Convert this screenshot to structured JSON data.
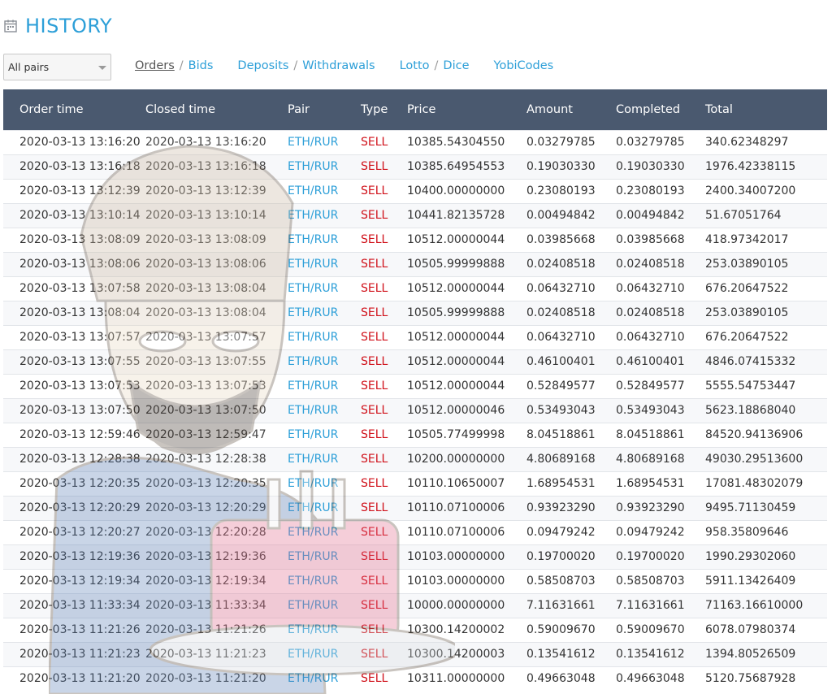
{
  "header": {
    "title": "HISTORY",
    "icon": "calendar-icon"
  },
  "filter": {
    "selected": "All pairs"
  },
  "nav": [
    {
      "label": "Orders",
      "active": true
    },
    {
      "label": "Bids",
      "active": false
    },
    {
      "label": "Deposits",
      "active": false
    },
    {
      "label": "Withdrawals",
      "active": false
    },
    {
      "label": "Lotto",
      "active": false
    },
    {
      "label": "Dice",
      "active": false
    },
    {
      "label": "YobiCodes",
      "active": false
    }
  ],
  "table": {
    "headers": [
      "Order time",
      "Closed time",
      "Pair",
      "Type",
      "Price",
      "Amount",
      "Completed",
      "Total"
    ],
    "rows": [
      [
        "2020-03-13 13:16:20",
        "2020-03-13 13:16:20",
        "ETH/RUR",
        "SELL",
        "10385.54304550",
        "0.03279785",
        "0.03279785",
        "340.62348297"
      ],
      [
        "2020-03-13 13:16:18",
        "2020-03-13 13:16:18",
        "ETH/RUR",
        "SELL",
        "10385.64954553",
        "0.19030330",
        "0.19030330",
        "1976.42338115"
      ],
      [
        "2020-03-13 13:12:39",
        "2020-03-13 13:12:39",
        "ETH/RUR",
        "SELL",
        "10400.00000000",
        "0.23080193",
        "0.23080193",
        "2400.34007200"
      ],
      [
        "2020-03-13 13:10:14",
        "2020-03-13 13:10:14",
        "ETH/RUR",
        "SELL",
        "10441.82135728",
        "0.00494842",
        "0.00494842",
        "51.67051764"
      ],
      [
        "2020-03-13 13:08:09",
        "2020-03-13 13:08:09",
        "ETH/RUR",
        "SELL",
        "10512.00000044",
        "0.03985668",
        "0.03985668",
        "418.97342017"
      ],
      [
        "2020-03-13 13:08:06",
        "2020-03-13 13:08:06",
        "ETH/RUR",
        "SELL",
        "10505.99999888",
        "0.02408518",
        "0.02408518",
        "253.03890105"
      ],
      [
        "2020-03-13 13:07:58",
        "2020-03-13 13:08:04",
        "ETH/RUR",
        "SELL",
        "10512.00000044",
        "0.06432710",
        "0.06432710",
        "676.20647522"
      ],
      [
        "2020-03-13 13:08:04",
        "2020-03-13 13:08:04",
        "ETH/RUR",
        "SELL",
        "10505.99999888",
        "0.02408518",
        "0.02408518",
        "253.03890105"
      ],
      [
        "2020-03-13 13:07:57",
        "2020-03-13 13:07:57",
        "ETH/RUR",
        "SELL",
        "10512.00000044",
        "0.06432710",
        "0.06432710",
        "676.20647522"
      ],
      [
        "2020-03-13 13:07:55",
        "2020-03-13 13:07:55",
        "ETH/RUR",
        "SELL",
        "10512.00000044",
        "0.46100401",
        "0.46100401",
        "4846.07415332"
      ],
      [
        "2020-03-13 13:07:53",
        "2020-03-13 13:07:53",
        "ETH/RUR",
        "SELL",
        "10512.00000044",
        "0.52849577",
        "0.52849577",
        "5555.54753447"
      ],
      [
        "2020-03-13 13:07:50",
        "2020-03-13 13:07:50",
        "ETH/RUR",
        "SELL",
        "10512.00000046",
        "0.53493043",
        "0.53493043",
        "5623.18868040"
      ],
      [
        "2020-03-13 12:59:46",
        "2020-03-13 12:59:47",
        "ETH/RUR",
        "SELL",
        "10505.77499998",
        "8.04518861",
        "8.04518861",
        "84520.94136906"
      ],
      [
        "2020-03-13 12:28:38",
        "2020-03-13 12:28:38",
        "ETH/RUR",
        "SELL",
        "10200.00000000",
        "4.80689168",
        "4.80689168",
        "49030.29513600"
      ],
      [
        "2020-03-13 12:20:35",
        "2020-03-13 12:20:35",
        "ETH/RUR",
        "SELL",
        "10110.10650007",
        "1.68954531",
        "1.68954531",
        "17081.48302079"
      ],
      [
        "2020-03-13 12:20:29",
        "2020-03-13 12:20:29",
        "ETH/RUR",
        "SELL",
        "10110.07100006",
        "0.93923290",
        "0.93923290",
        "9495.71130459"
      ],
      [
        "2020-03-13 12:20:27",
        "2020-03-13 12:20:28",
        "ETH/RUR",
        "SELL",
        "10110.07100006",
        "0.09479242",
        "0.09479242",
        "958.35809646"
      ],
      [
        "2020-03-13 12:19:36",
        "2020-03-13 12:19:36",
        "ETH/RUR",
        "SELL",
        "10103.00000000",
        "0.19700020",
        "0.19700020",
        "1990.29302060"
      ],
      [
        "2020-03-13 12:19:34",
        "2020-03-13 12:19:34",
        "ETH/RUR",
        "SELL",
        "10103.00000000",
        "0.58508703",
        "0.58508703",
        "5911.13426409"
      ],
      [
        "2020-03-13 11:33:34",
        "2020-03-13 11:33:34",
        "ETH/RUR",
        "SELL",
        "10000.00000000",
        "7.11631661",
        "7.11631661",
        "71163.16610000"
      ],
      [
        "2020-03-13 11:21:26",
        "2020-03-13 11:21:26",
        "ETH/RUR",
        "SELL",
        "10300.14200002",
        "0.59009670",
        "0.59009670",
        "6078.07980374"
      ],
      [
        "2020-03-13 11:21:23",
        "2020-03-13 11:21:23",
        "ETH/RUR",
        "SELL",
        "10300.14200003",
        "0.13541612",
        "0.13541612",
        "1394.80526509"
      ],
      [
        "2020-03-13 11:21:20",
        "2020-03-13 11:21:20",
        "ETH/RUR",
        "SELL",
        "10311.00000000",
        "0.49663048",
        "0.49663048",
        "5120.75687928"
      ]
    ]
  },
  "colors": {
    "accent": "#2d9fd8",
    "header_bg": "#4a596f",
    "sell": "#d0111a"
  }
}
